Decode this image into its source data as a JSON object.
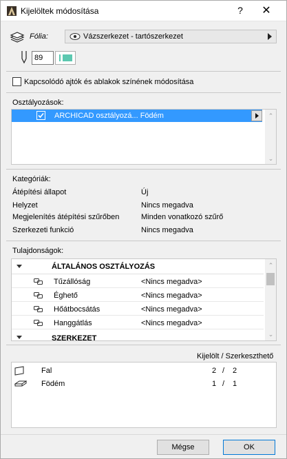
{
  "window": {
    "title": "Kijelöltek módosítása",
    "help": "?",
    "close": "✕"
  },
  "layer": {
    "label": "Fólia:",
    "value": "Vázszerkezet - tartószerkezet"
  },
  "pen": {
    "value": "89"
  },
  "doors_windows": {
    "label": "Kapcsolódó ajtók és ablakok színének módosítása",
    "checked": false
  },
  "classifications": {
    "label": "Osztályozások:",
    "items": [
      {
        "text": "ARCHICAD osztályozá... Födém",
        "checked": true,
        "selected": true
      }
    ]
  },
  "categories": {
    "label": "Kategóriák:",
    "rows": [
      {
        "key": "Átépítési állapot",
        "value": "Új"
      },
      {
        "key": "Helyzet",
        "value": "Nincs megadva"
      },
      {
        "key": "Megjelenítés átépítési szűrőben",
        "value": "Minden vonatkozó szűrő"
      },
      {
        "key": "Szerkezeti funkció",
        "value": "Nincs megadva"
      }
    ]
  },
  "properties": {
    "label": "Tulajdonságok:",
    "groups": [
      {
        "name": "ÁLTALÁNOS OSZTÁLYOZÁS",
        "rows": [
          {
            "name": "Tűzállóság",
            "value": "<Nincs megadva>"
          },
          {
            "name": "Éghető",
            "value": "<Nincs megadva>"
          },
          {
            "name": "Hőátbocsátás",
            "value": "<Nincs megadva>"
          },
          {
            "name": "Hanggátlás",
            "value": "<Nincs megadva>"
          }
        ]
      },
      {
        "name": "SZERKEZET",
        "rows": []
      }
    ]
  },
  "selection": {
    "header": "Kijelölt / Szerkeszthető",
    "rows": [
      {
        "icon": "wall-icon",
        "name": "Fal",
        "selected": "2",
        "sep": "/",
        "editable": "2"
      },
      {
        "icon": "slab-icon",
        "name": "Födém",
        "selected": "1",
        "sep": "/",
        "editable": "1"
      }
    ]
  },
  "buttons": {
    "cancel": "Mégse",
    "ok": "OK"
  },
  "colors": {
    "selection_blue": "#3399ff",
    "pen_swatch": "#5cc8b0"
  }
}
